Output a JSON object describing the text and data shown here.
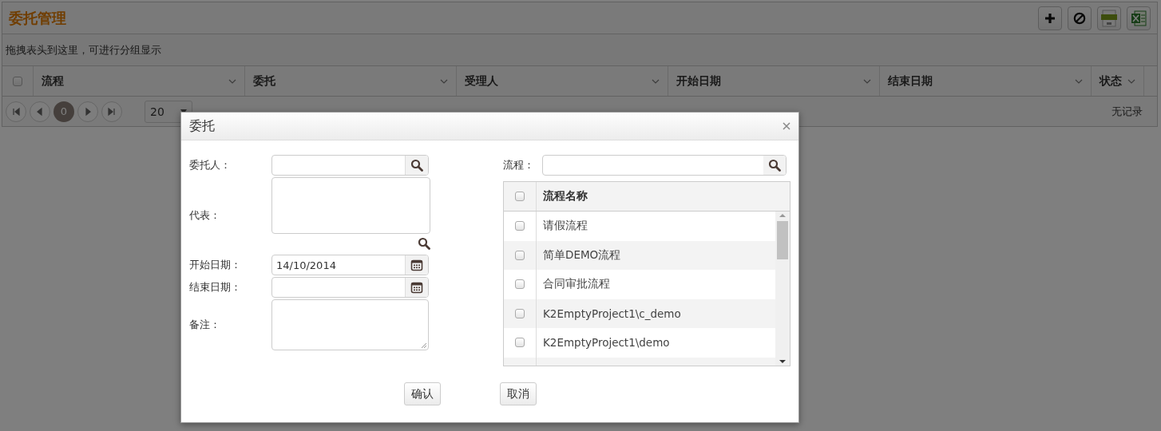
{
  "page": {
    "title": "委托管理",
    "toolbar": [
      {
        "kind": "add"
      },
      {
        "kind": "disable"
      },
      {
        "kind": "csv"
      },
      {
        "kind": "excel"
      }
    ],
    "group_hint": "拖拽表头到这里，可进行分组显示",
    "grid": {
      "select_all_checked": false,
      "columns": [
        "流程",
        "委托",
        "受理人",
        "开始日期",
        "结束日期",
        "状态"
      ]
    },
    "pager": {
      "current_page": "0",
      "page_size": "20",
      "status": "无记录"
    }
  },
  "dialog": {
    "title": "委托",
    "fields": [
      {
        "label": "委托人：",
        "kind": "lookup"
      },
      {
        "label": "代表：",
        "kind": "multi_lookup"
      },
      {
        "label": "开始日期：",
        "kind": "date",
        "value": "14/10/2014"
      },
      {
        "label": "结束日期：",
        "kind": "date"
      },
      {
        "label": "备注：",
        "kind": "textarea"
      }
    ],
    "process_search": {
      "label": "流程："
    },
    "process_list": {
      "header": "流程名称",
      "select_all_checked": false,
      "rows": [
        {
          "name": "请假流程",
          "checked": false
        },
        {
          "name": "简单DEMO流程",
          "checked": false
        },
        {
          "name": "合同审批流程",
          "checked": false
        },
        {
          "name": "K2EmptyProject1\\c_demo",
          "checked": false
        },
        {
          "name": "K2EmptyProject1\\demo",
          "checked": false
        }
      ]
    },
    "buttons": [
      "确认",
      "取消"
    ]
  }
}
